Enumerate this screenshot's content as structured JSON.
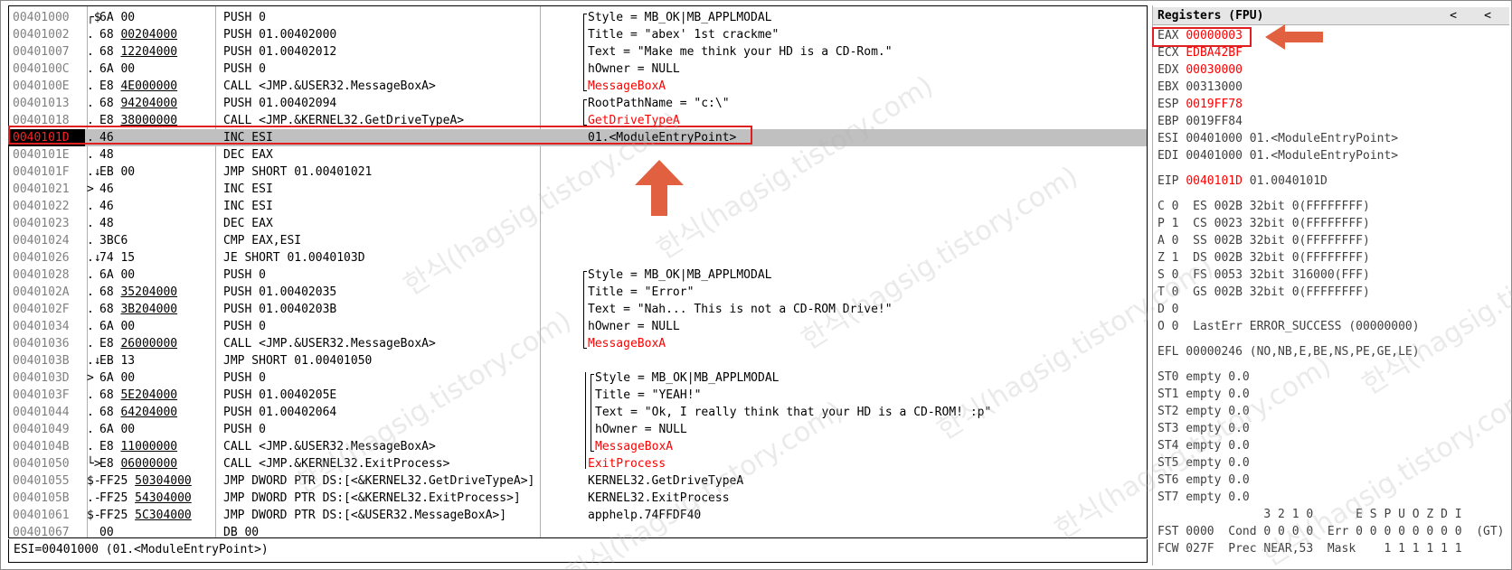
{
  "disasm": {
    "rows": [
      {
        "addr": "00401000",
        "arrow": "┌$",
        "bytes": "6A 00",
        "instr": "PUSH 0",
        "cmt": "Style = MB_OK|MB_APPLMODAL",
        "cmt_color": "gray_label"
      },
      {
        "addr": "00401002",
        "arrow": ".",
        "bytes": "68 00204000",
        "instr": "PUSH 01.00402000",
        "cmt": "Title = \"abex' 1st crackme\""
      },
      {
        "addr": "00401007",
        "arrow": ".",
        "bytes": "68 12204000",
        "instr": "PUSH 01.00402012",
        "cmt": "Text = \"Make me think your HD is a CD-Rom.\""
      },
      {
        "addr": "0040100C",
        "arrow": ".",
        "bytes": "6A 00",
        "instr": "PUSH 0",
        "cmt": "hOwner = NULL"
      },
      {
        "addr": "0040100E",
        "arrow": ".",
        "bytes": "E8 4E000000",
        "instr": "CALL <JMP.&USER32.MessageBoxA>",
        "cmt": "MessageBoxA"
      },
      {
        "addr": "00401013",
        "arrow": ".",
        "bytes": "68 94204000",
        "instr": "PUSH 01.00402094",
        "cmt": "RootPathName = \"c:\\\""
      },
      {
        "addr": "00401018",
        "arrow": ".",
        "bytes": "E8 38000000",
        "instr": "CALL <JMP.&KERNEL32.GetDriveTypeA>",
        "cmt": "GetDriveTypeA"
      },
      {
        "addr": "0040101D",
        "arrow": ".",
        "bytes": "46",
        "instr": "INC ESI",
        "cmt": "01.<ModuleEntryPoint>"
      },
      {
        "addr": "0040101E",
        "arrow": ".",
        "bytes": "48",
        "instr": "DEC EAX",
        "cmt": ""
      },
      {
        "addr": "0040101F",
        "arrow": ".↓",
        "bytes": "EB 00",
        "instr": "JMP SHORT 01.00401021",
        "cmt": ""
      },
      {
        "addr": "00401021",
        "arrow": ">",
        "bytes": "46",
        "instr": "INC ESI",
        "cmt": ""
      },
      {
        "addr": "00401022",
        "arrow": ".",
        "bytes": "46",
        "instr": "INC ESI",
        "cmt": ""
      },
      {
        "addr": "00401023",
        "arrow": ".",
        "bytes": "48",
        "instr": "DEC EAX",
        "cmt": ""
      },
      {
        "addr": "00401024",
        "arrow": ".",
        "bytes": "3BC6",
        "instr": "CMP EAX,ESI",
        "cmt": ""
      },
      {
        "addr": "00401026",
        "arrow": ".↓",
        "bytes": "74 15",
        "instr": "JE SHORT 01.0040103D",
        "cmt": ""
      },
      {
        "addr": "00401028",
        "arrow": ".",
        "bytes": "6A 00",
        "instr": "PUSH 0",
        "cmt": "Style = MB_OK|MB_APPLMODAL"
      },
      {
        "addr": "0040102A",
        "arrow": ".",
        "bytes": "68 35204000",
        "instr": "PUSH 01.00402035",
        "cmt": "Title = \"Error\""
      },
      {
        "addr": "0040102F",
        "arrow": ".",
        "bytes": "68 3B204000",
        "instr": "PUSH 01.0040203B",
        "cmt": "Text = \"Nah... This is not a CD-ROM Drive!\""
      },
      {
        "addr": "00401034",
        "arrow": ".",
        "bytes": "6A 00",
        "instr": "PUSH 0",
        "cmt": "hOwner = NULL"
      },
      {
        "addr": "00401036",
        "arrow": ".",
        "bytes": "E8 26000000",
        "instr": "CALL <JMP.&USER32.MessageBoxA>",
        "cmt": "MessageBoxA"
      },
      {
        "addr": "0040103B",
        "arrow": ".↓",
        "bytes": "EB 13",
        "instr": "JMP SHORT 01.00401050",
        "cmt": ""
      },
      {
        "addr": "0040103D",
        "arrow": ">",
        "bytes": "6A 00",
        "instr": "PUSH 0",
        "cmt": "Style = MB_OK|MB_APPLMODAL"
      },
      {
        "addr": "0040103F",
        "arrow": ".",
        "bytes": "68 5E204000",
        "instr": "PUSH 01.0040205E",
        "cmt": "Title = \"YEAH!\""
      },
      {
        "addr": "00401044",
        "arrow": ".",
        "bytes": "68 64204000",
        "instr": "PUSH 01.00402064",
        "cmt": "Text = \"Ok, I really think that your HD is a CD-ROM! :p\""
      },
      {
        "addr": "00401049",
        "arrow": ".",
        "bytes": "6A 00",
        "instr": "PUSH 0",
        "cmt": "hOwner = NULL"
      },
      {
        "addr": "0040104B",
        "arrow": ".",
        "bytes": "E8 11000000",
        "instr": "CALL <JMP.&USER32.MessageBoxA>",
        "cmt": "MessageBoxA"
      },
      {
        "addr": "00401050",
        "arrow": "└>",
        "bytes": "E8 06000000",
        "instr": "CALL <JMP.&KERNEL32.ExitProcess>",
        "cmt": "ExitProcess"
      },
      {
        "addr": "00401055",
        "arrow": "$-",
        "bytes": "FF25 50304000",
        "instr": "JMP DWORD PTR DS:[<&KERNEL32.GetDriveTypeA>]",
        "cmt": "KERNEL32.GetDriveTypeA"
      },
      {
        "addr": "0040105B",
        "arrow": ".-",
        "bytes": "FF25 54304000",
        "instr": "JMP DWORD PTR DS:[<&KERNEL32.ExitProcess>]",
        "cmt": "KERNEL32.ExitProcess"
      },
      {
        "addr": "00401061",
        "arrow": "$-",
        "bytes": "FF25 5C304000",
        "instr": "JMP DWORD PTR DS:[<&USER32.MessageBoxA>]",
        "cmt": "apphelp.74FFDF40"
      },
      {
        "addr": "00401067",
        "arrow": "",
        "bytes": "00",
        "instr": "DB 00",
        "cmt": ""
      }
    ],
    "selected_index": 7
  },
  "statusbar": {
    "text": "ESI=00401000 (01.<ModuleEntryPoint>)"
  },
  "registers": {
    "title": "Registers (FPU)",
    "nav_left": "<",
    "nav_left2": "<",
    "gp": [
      {
        "name": "EAX",
        "value": "00000003",
        "extra": "",
        "changed": true
      },
      {
        "name": "ECX",
        "value": "EDBA42BF",
        "extra": "",
        "changed": true
      },
      {
        "name": "EDX",
        "value": "00030000",
        "extra": "",
        "changed": true
      },
      {
        "name": "EBX",
        "value": "00313000",
        "extra": "",
        "changed": false
      },
      {
        "name": "ESP",
        "value": "0019FF78",
        "extra": "",
        "changed": true
      },
      {
        "name": "EBP",
        "value": "0019FF84",
        "extra": "",
        "changed": false
      },
      {
        "name": "ESI",
        "value": "00401000",
        "extra": "01.<ModuleEntryPoint>",
        "changed": false
      },
      {
        "name": "EDI",
        "value": "00401000",
        "extra": "01.<ModuleEntryPoint>",
        "changed": false
      }
    ],
    "eip": {
      "name": "EIP",
      "value": "0040101D",
      "extra": "01.0040101D"
    },
    "flags": [
      "C 0  ES 002B 32bit 0(FFFFFFFF)",
      "P 1  CS 0023 32bit 0(FFFFFFFF)",
      "A 0  SS 002B 32bit 0(FFFFFFFF)",
      "Z 1  DS 002B 32bit 0(FFFFFFFF)",
      "S 0  FS 0053 32bit 316000(FFF)",
      "T 0  GS 002B 32bit 0(FFFFFFFF)",
      "D 0",
      "O 0  LastErr ERROR_SUCCESS (00000000)"
    ],
    "efl": "EFL 00000246 (NO,NB,E,BE,NS,PE,GE,LE)",
    "st": [
      "ST0 empty 0.0",
      "ST1 empty 0.0",
      "ST2 empty 0.0",
      "ST3 empty 0.0",
      "ST4 empty 0.0",
      "ST5 empty 0.0",
      "ST6 empty 0.0",
      "ST7 empty 0.0"
    ],
    "fpu_header": "               3 2 1 0      E S P U O Z D I",
    "fst": "FST 0000  Cond 0 0 0 0  Err 0 0 0 0 0 0 0 0  (GT)",
    "fcw": "FCW 027F  Prec NEAR,53  Mask    1 1 1 1 1 1"
  },
  "colors": {
    "accent_red": "#e02020",
    "annotation_orange": "#e06040",
    "selected_row": "#c0c0c0"
  },
  "watermark": "한식(hagsig.tistory.com)"
}
